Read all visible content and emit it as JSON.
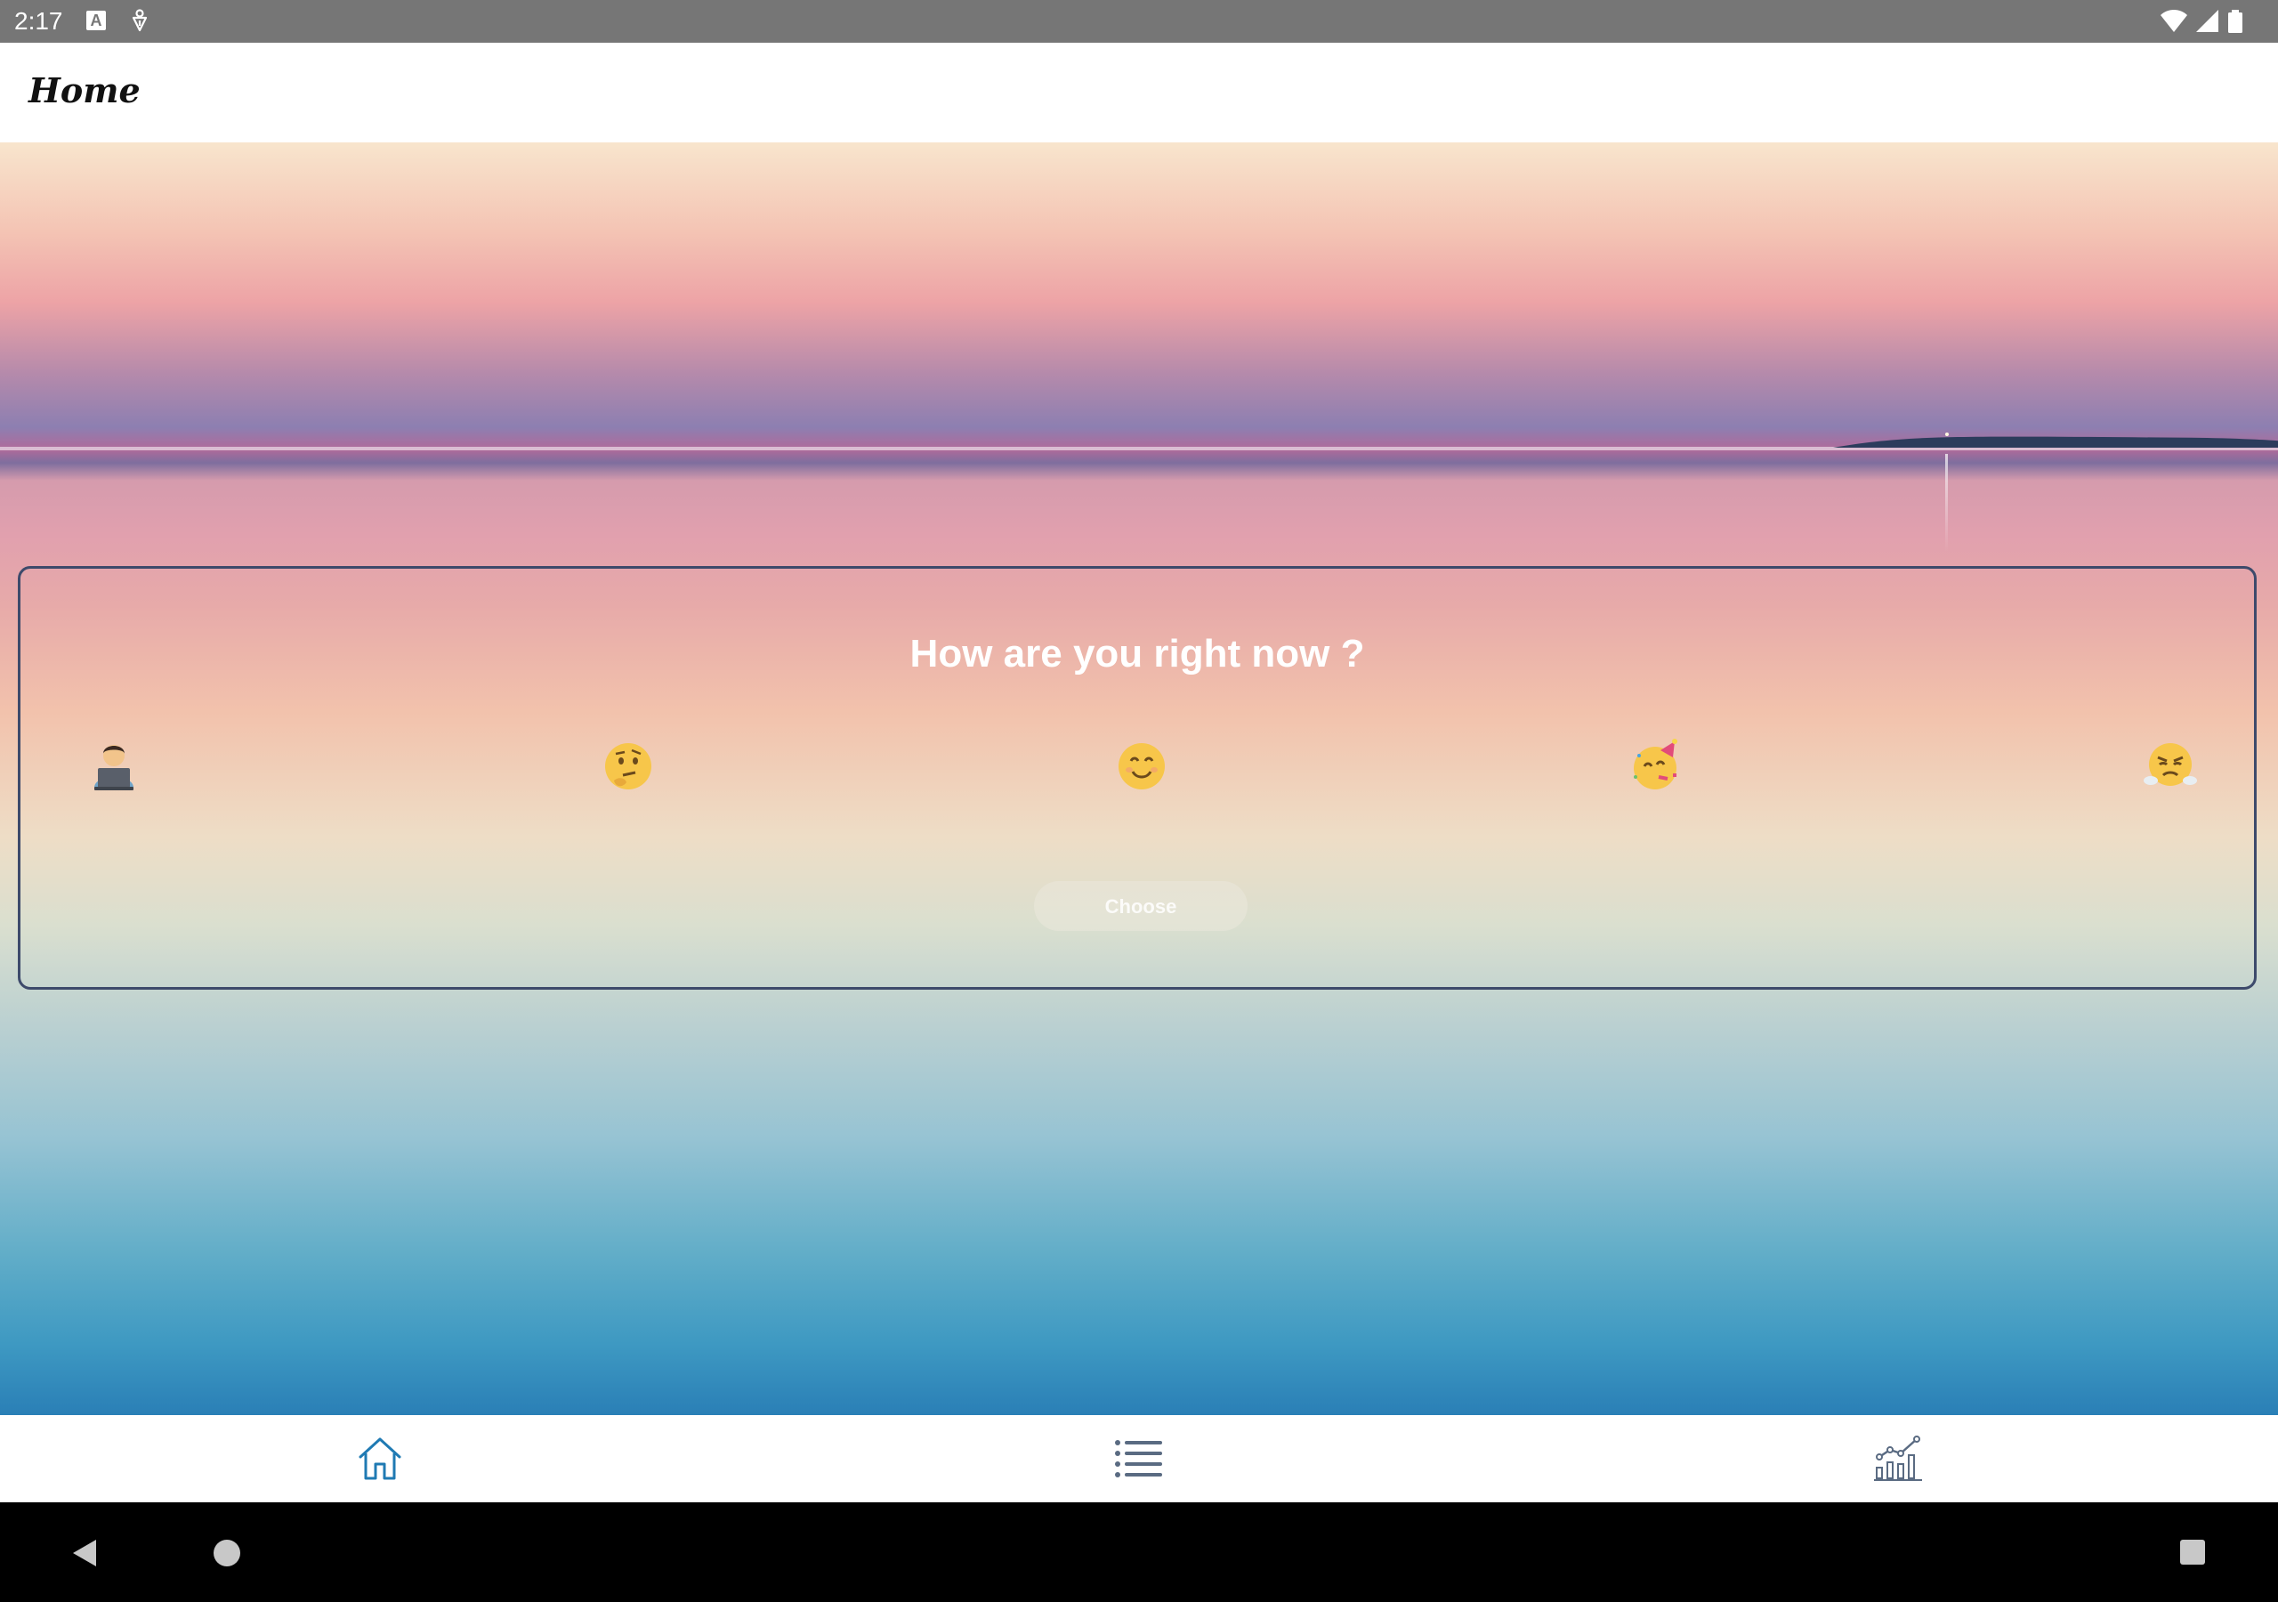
{
  "status_bar": {
    "time": "2:17",
    "notification_letter": "A",
    "icons": [
      "a-notification-icon",
      "debug-icon",
      "wifi-icon",
      "signal-icon",
      "battery-icon"
    ]
  },
  "app_bar": {
    "title": "Home"
  },
  "mood_card": {
    "question": "How are you right now ?",
    "emojis": [
      "🧑‍💻",
      "🤔",
      "😊",
      "🥳",
      "😤"
    ],
    "choose_label": "Choose"
  },
  "bottom_nav": {
    "items": [
      "home-icon",
      "list-icon",
      "chart-icon"
    ],
    "active_color": "#1f7ab3",
    "inactive_color": "#5a6b82"
  },
  "system_nav": {
    "buttons": [
      "back-icon",
      "home-circle-icon",
      "recents-icon"
    ]
  }
}
